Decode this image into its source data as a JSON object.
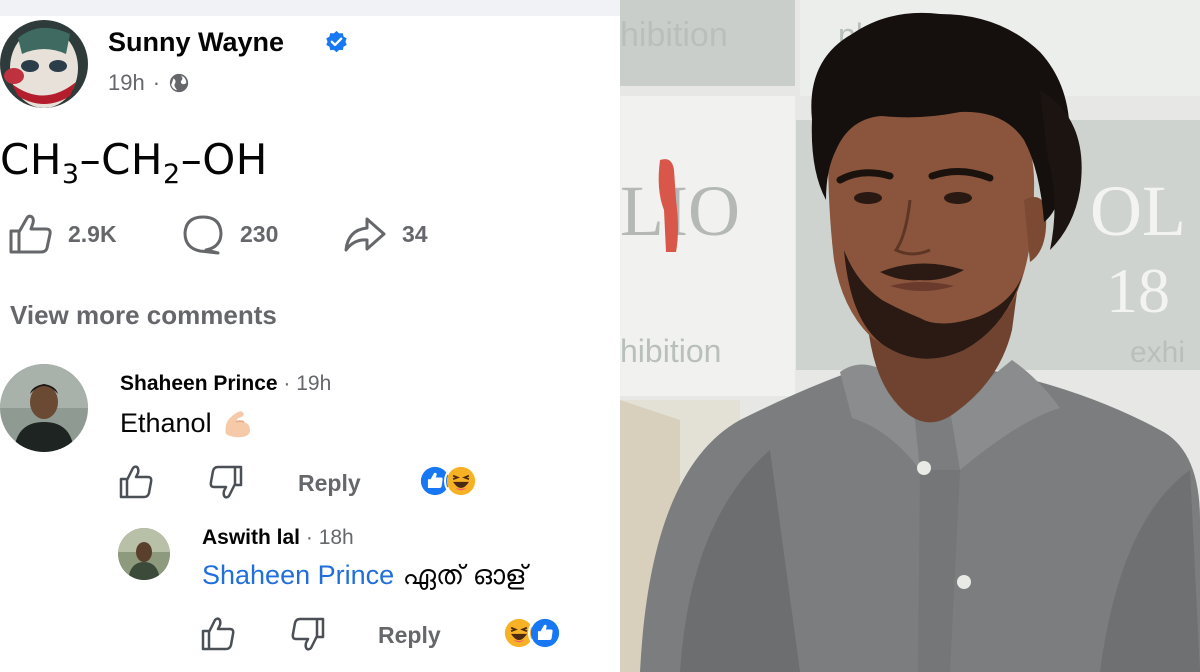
{
  "post": {
    "author": "Sunny Wayne",
    "time": "19h",
    "separator": "·",
    "formula": {
      "a": "CH",
      "a_sub": "3",
      "b": "–CH",
      "b_sub": "2",
      "c": "–OH"
    },
    "likes": "2.9K",
    "comments": "230",
    "shares": "34",
    "view_more": "View more comments"
  },
  "comments": [
    {
      "name": "Shaheen Prince",
      "time": "· 19h",
      "text": "Ethanol",
      "reply": "Reply",
      "reactions": [
        "like-reaction",
        "haha-reaction"
      ]
    },
    {
      "name": "Aswith lal",
      "time": "· 18h",
      "mention": "Shaheen Prince",
      "text": " ഏത് ഓള്",
      "reply": "Reply",
      "reactions": [
        "haha-reaction",
        "like-reaction"
      ]
    }
  ],
  "photo": {
    "banner_texts": [
      "hibition",
      "photo exh",
      "LIO",
      "OL",
      "18",
      "hibition",
      "exhi"
    ]
  },
  "colors": {
    "fb_blue": "#1877f2",
    "mention_blue": "#216fdb",
    "meta_gray": "#65676b"
  }
}
